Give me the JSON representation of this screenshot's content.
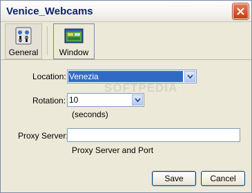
{
  "window": {
    "title": "Venice_Webcams"
  },
  "toolbar": {
    "general_label": "General",
    "window_label": "Window"
  },
  "form": {
    "location_label": "Location:",
    "location_value": "Venezia",
    "rotation_label": "Rotation:",
    "rotation_value": "10",
    "rotation_unit": "(seconds)",
    "proxy_label": "Proxy Server:",
    "proxy_value": "",
    "proxy_hint": "Proxy Server and Port"
  },
  "buttons": {
    "save": "Save",
    "cancel": "Cancel"
  },
  "watermark": "SOFTPEDIA",
  "colors": {
    "title": "#0a246a",
    "selection": "#316ac5",
    "close": "#c83c14"
  }
}
